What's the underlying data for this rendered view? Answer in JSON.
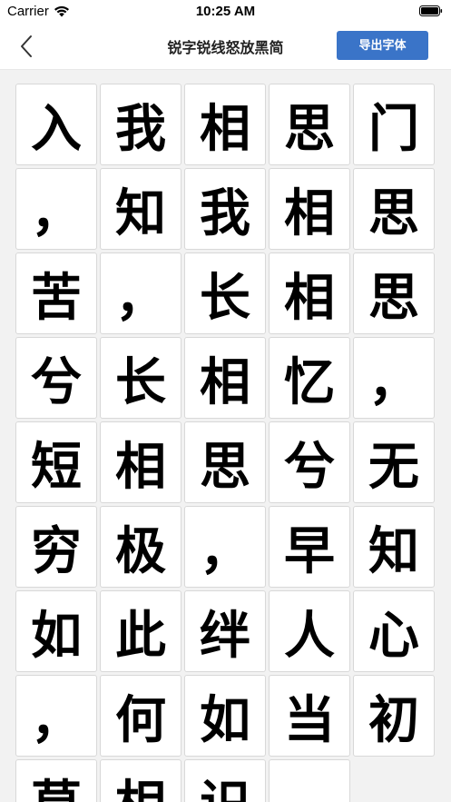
{
  "status_bar": {
    "carrier": "Carrier",
    "time": "10:25 AM"
  },
  "nav": {
    "title": "锐字锐线怒放黑简",
    "export_label": "导出字体"
  },
  "colors": {
    "accent": "#3a74c8",
    "background": "#f2f2f2"
  },
  "characters": [
    "入",
    "我",
    "相",
    "思",
    "门",
    "，",
    "知",
    "我",
    "相",
    "思",
    "苦",
    "，",
    "长",
    "相",
    "思",
    "兮",
    "长",
    "相",
    "忆",
    "，",
    "短",
    "相",
    "思",
    "兮",
    "无",
    "穷",
    "极",
    "，",
    "早",
    "知",
    "如",
    "此",
    "绊",
    "人",
    "心",
    "，",
    "何",
    "如",
    "当",
    "初",
    "莫",
    "相",
    "识",
    ""
  ]
}
